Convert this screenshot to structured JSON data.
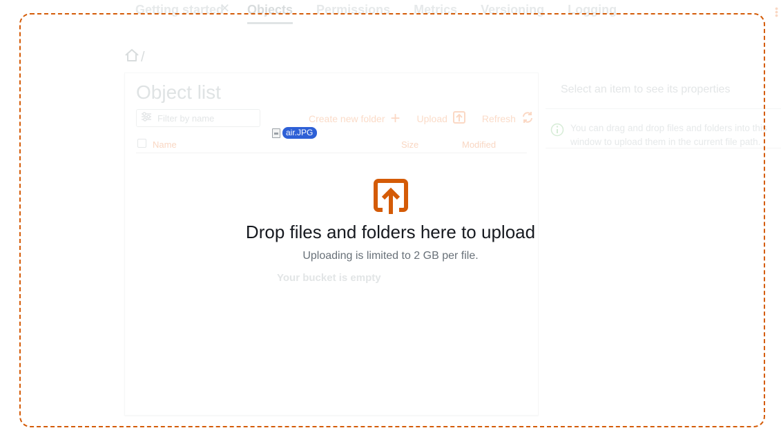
{
  "tabs": [
    {
      "label": "Getting started"
    },
    {
      "label": "Objects"
    },
    {
      "label": "Permissions"
    },
    {
      "label": "Metrics"
    },
    {
      "label": "Versioning"
    },
    {
      "label": "Logging"
    }
  ],
  "breadcrumb": {
    "separator": "/"
  },
  "object_list": {
    "title": "Object list",
    "filter_placeholder": "Filter by name",
    "toolbar": {
      "create_folder": "Create new folder",
      "upload": "Upload",
      "refresh": "Refresh"
    },
    "columns": {
      "name": "Name",
      "size": "Size",
      "modified": "Modified"
    },
    "empty_message": "Your bucket is empty"
  },
  "properties": {
    "title": "Select an item to see its properties",
    "info": "You can drag and drop files and folders into this window to upload them in the current file path."
  },
  "dropzone": {
    "title": "Drop files and folders here to upload",
    "subtitle": "Uploading is limited to 2 GB per file.",
    "accent_color": "#d45b07"
  },
  "drag_item": {
    "filename": "air.JPG"
  }
}
